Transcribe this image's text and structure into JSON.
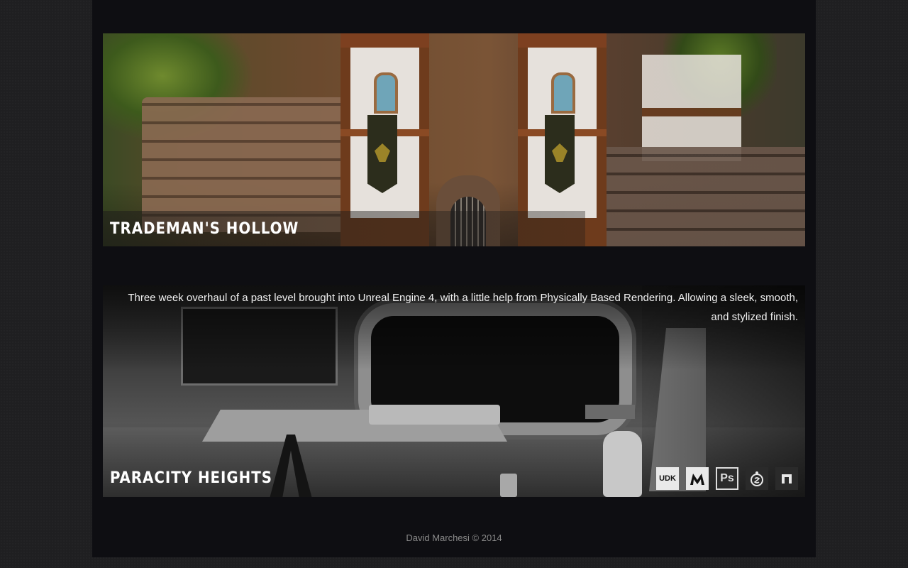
{
  "projects": [
    {
      "title": "Trademan's Hollow",
      "description": ""
    },
    {
      "title": "Paracity Heights",
      "description": "Three week overhaul of a past level brought into Unreal Engine 4, with a little help from Physically Based Rendering. Allowing a sleek, smooth, and stylized finish.",
      "tools": [
        {
          "label": "UDK",
          "icon": "udk-icon"
        },
        {
          "label": "",
          "icon": "unreal-engine-icon"
        },
        {
          "label": "Ps",
          "icon": "photoshop-icon"
        },
        {
          "label": "",
          "icon": "substance-icon"
        },
        {
          "label": "n",
          "icon": "ndo-icon"
        }
      ]
    }
  ],
  "footer": {
    "text": "David Marchesi © 2014"
  }
}
